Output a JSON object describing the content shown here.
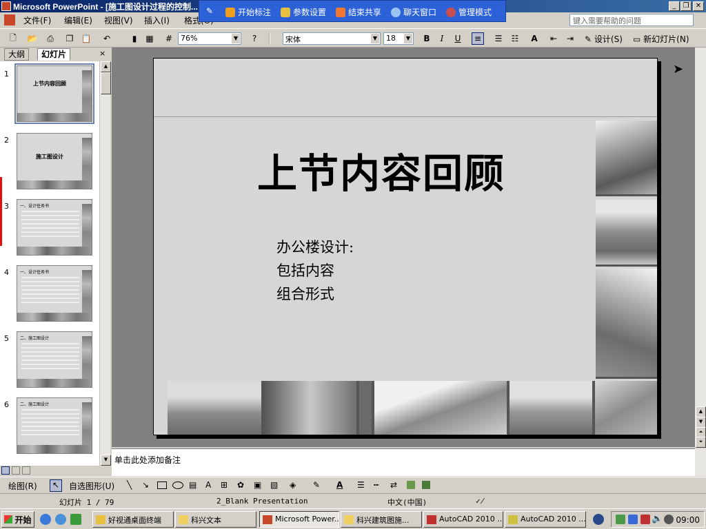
{
  "window": {
    "app_title": "Microsoft PowerPoint - [施工图设计过程的控制..."
  },
  "overlay": {
    "items": [
      "开始标注",
      "参数设置",
      "结束共享",
      "聊天窗口",
      "管理模式"
    ]
  },
  "menu": {
    "items": [
      "文件(F)",
      "编辑(E)",
      "视图(V)",
      "插入(I)",
      "格式(O)"
    ],
    "help_placeholder": "键入需要帮助的问题"
  },
  "toolbar": {
    "zoom": "76%",
    "font": "宋体",
    "font_size": "18",
    "bold": "B",
    "italic": "I",
    "underline": "U",
    "design_label": "设计(S)",
    "new_slide_label": "新幻灯片(N)"
  },
  "pane": {
    "tabs": [
      "大纲",
      "幻灯片"
    ],
    "close": "×",
    "thumbs": [
      {
        "num": "1",
        "title": "上节内容回顾",
        "kind": "title"
      },
      {
        "num": "2",
        "title": "施工图设计",
        "kind": "title"
      },
      {
        "num": "3",
        "title": "",
        "kind": "text",
        "head": "一、设计任务书"
      },
      {
        "num": "4",
        "title": "",
        "kind": "text",
        "head": "一、设计任务书"
      },
      {
        "num": "5",
        "title": "",
        "kind": "text",
        "head": "二、施工图设计"
      },
      {
        "num": "6",
        "title": "",
        "kind": "text",
        "head": "二、施工图设计"
      }
    ]
  },
  "slide": {
    "title": "上节内容回顾",
    "bullets": [
      "办公楼设计:",
      "包括内容",
      "组合形式"
    ]
  },
  "notes": {
    "placeholder": "单击此处添加备注"
  },
  "drawbar": {
    "draw_label": "绘图(R)",
    "autoshape_label": "自选图形(U)"
  },
  "status": {
    "slide_pos": "幻灯片 1 / 79",
    "template": "2_Blank Presentation",
    "language": "中文(中国)"
  },
  "taskbar": {
    "start": "开始",
    "tasks": [
      {
        "label": "好视通桌面终端",
        "active": false
      },
      {
        "label": "科兴文本",
        "active": false
      },
      {
        "label": "Microsoft Power...",
        "active": true
      },
      {
        "label": "科兴建筑图施...",
        "active": false
      },
      {
        "label": "AutoCAD 2010 ...",
        "active": false
      },
      {
        "label": "AutoCAD 2010 ...",
        "active": false
      }
    ],
    "clock": "09:00"
  }
}
